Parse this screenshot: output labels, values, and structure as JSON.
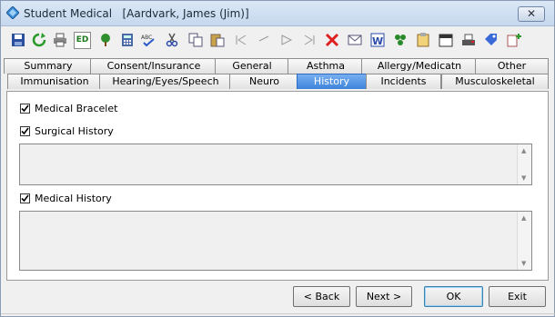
{
  "window": {
    "title": "Student Medical",
    "subtitle": "[Aardvark, James (Jim)]",
    "close_label": "✕"
  },
  "toolbar": {
    "icons": [
      "save-icon",
      "refresh-icon",
      "print-icon",
      "edit-icon",
      "tree-icon",
      "calculator-icon",
      "spellcheck-icon",
      "cut-icon",
      "copy-icon",
      "paste-icon",
      "first-record-icon",
      "previous-record-icon",
      "next-record-icon",
      "last-record-icon",
      "delete-icon",
      "email-icon",
      "word-icon",
      "excel-icon",
      "notes-icon",
      "calendar-icon",
      "scan-icon",
      "tag-icon",
      "clipboard-add-icon"
    ],
    "edit_label": "ED"
  },
  "tabs": {
    "row1": [
      "Summary",
      "Consent/Insurance",
      "General",
      "Asthma",
      "Allergy/Medicatn",
      "Other"
    ],
    "row2": [
      "Immunisation",
      "Hearing/Eyes/Speech",
      "Neuro",
      "History",
      "Incidents",
      "Musculoskeletal"
    ],
    "active": "History"
  },
  "panel": {
    "medical_bracelet": {
      "label": "Medical Bracelet",
      "checked": true
    },
    "surgical_history": {
      "label": "Surgical History",
      "checked": true,
      "value": ""
    },
    "medical_history": {
      "label": "Medical History",
      "checked": true,
      "value": ""
    }
  },
  "buttons": {
    "back": "< Back",
    "next": "Next >",
    "ok": "OK",
    "exit": "Exit"
  },
  "colors": {
    "active_tab": "#4a8fe0",
    "titlebar": "#d3e1f2",
    "delete_icon": "#e02020"
  }
}
